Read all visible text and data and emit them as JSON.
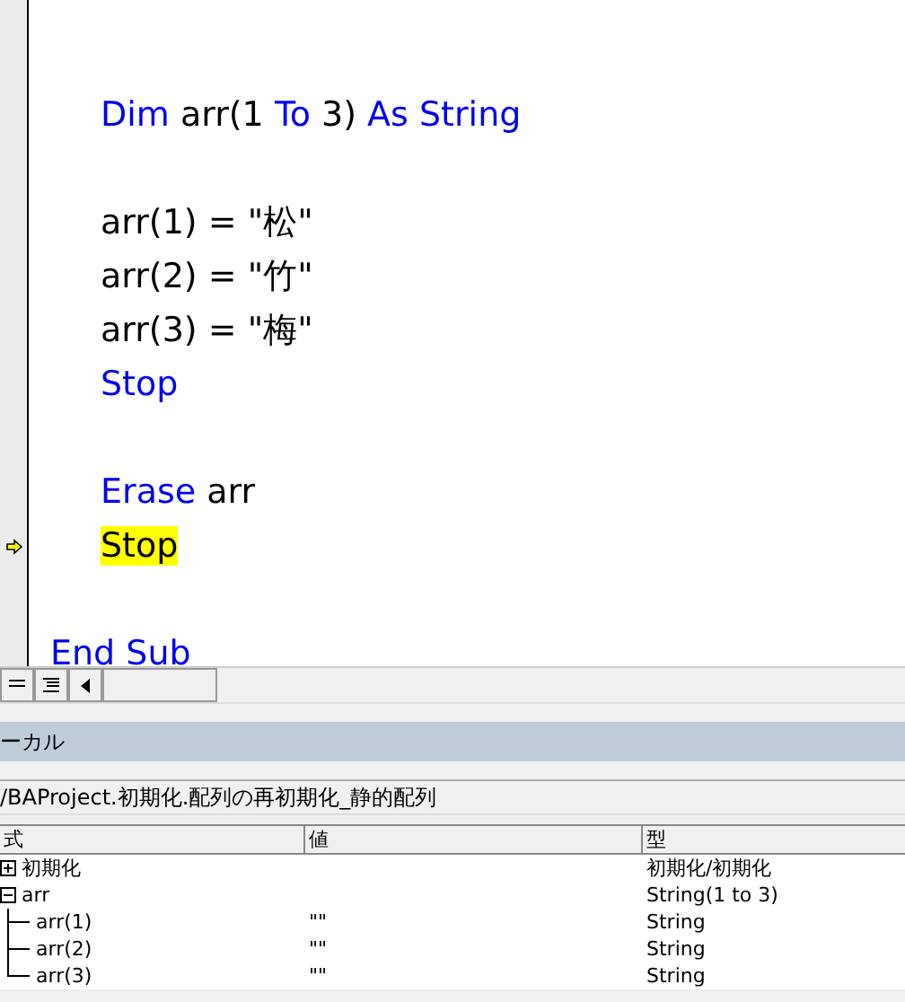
{
  "code_lines": [
    {
      "kind": "blank"
    },
    {
      "kind": "code",
      "tokens": [
        {
          "text": "Dim",
          "kind": "keyword"
        },
        {
          "text": " arr(1 ",
          "kind": "plain"
        },
        {
          "text": "To",
          "kind": "keyword"
        },
        {
          "text": " 3) ",
          "kind": "plain"
        },
        {
          "text": "As String",
          "kind": "keyword"
        }
      ]
    },
    {
      "kind": "blank"
    },
    {
      "kind": "code",
      "tokens": [
        {
          "text": "arr(1) = \"松\"",
          "kind": "plain"
        }
      ]
    },
    {
      "kind": "code",
      "tokens": [
        {
          "text": "arr(2) = \"竹\"",
          "kind": "plain"
        }
      ]
    },
    {
      "kind": "code",
      "tokens": [
        {
          "text": "arr(3) = \"梅\"",
          "kind": "plain"
        }
      ]
    },
    {
      "kind": "code",
      "tokens": [
        {
          "text": "Stop",
          "kind": "keyword"
        }
      ]
    },
    {
      "kind": "blank"
    },
    {
      "kind": "code",
      "tokens": [
        {
          "text": "Erase",
          "kind": "keyword"
        },
        {
          "text": " arr",
          "kind": "plain"
        }
      ]
    },
    {
      "kind": "code",
      "current": true,
      "tokens": [
        {
          "text": "Stop",
          "kind": "keyword",
          "highlighted": true
        }
      ]
    },
    {
      "kind": "blank"
    },
    {
      "kind": "end",
      "tokens": [
        {
          "text": "End Sub",
          "kind": "keyword"
        }
      ]
    }
  ],
  "locals": {
    "title": "ーカル",
    "context": "/BAProject.初期化.配列の再初期化_静的配列",
    "columns": [
      "式",
      "値",
      "型"
    ],
    "rows": [
      {
        "expression": "初期化",
        "type": "初期化/初期化",
        "expanded": false
      },
      {
        "expression": "arr",
        "type": "String(1 to 3)",
        "expanded": true,
        "children": [
          {
            "expression": "arr(1)",
            "value": "\"\"",
            "type": "String"
          },
          {
            "expression": "arr(2)",
            "value": "\"\"",
            "type": "String"
          },
          {
            "expression": "arr(3)",
            "value": "\"\"",
            "type": "String"
          }
        ]
      }
    ]
  }
}
